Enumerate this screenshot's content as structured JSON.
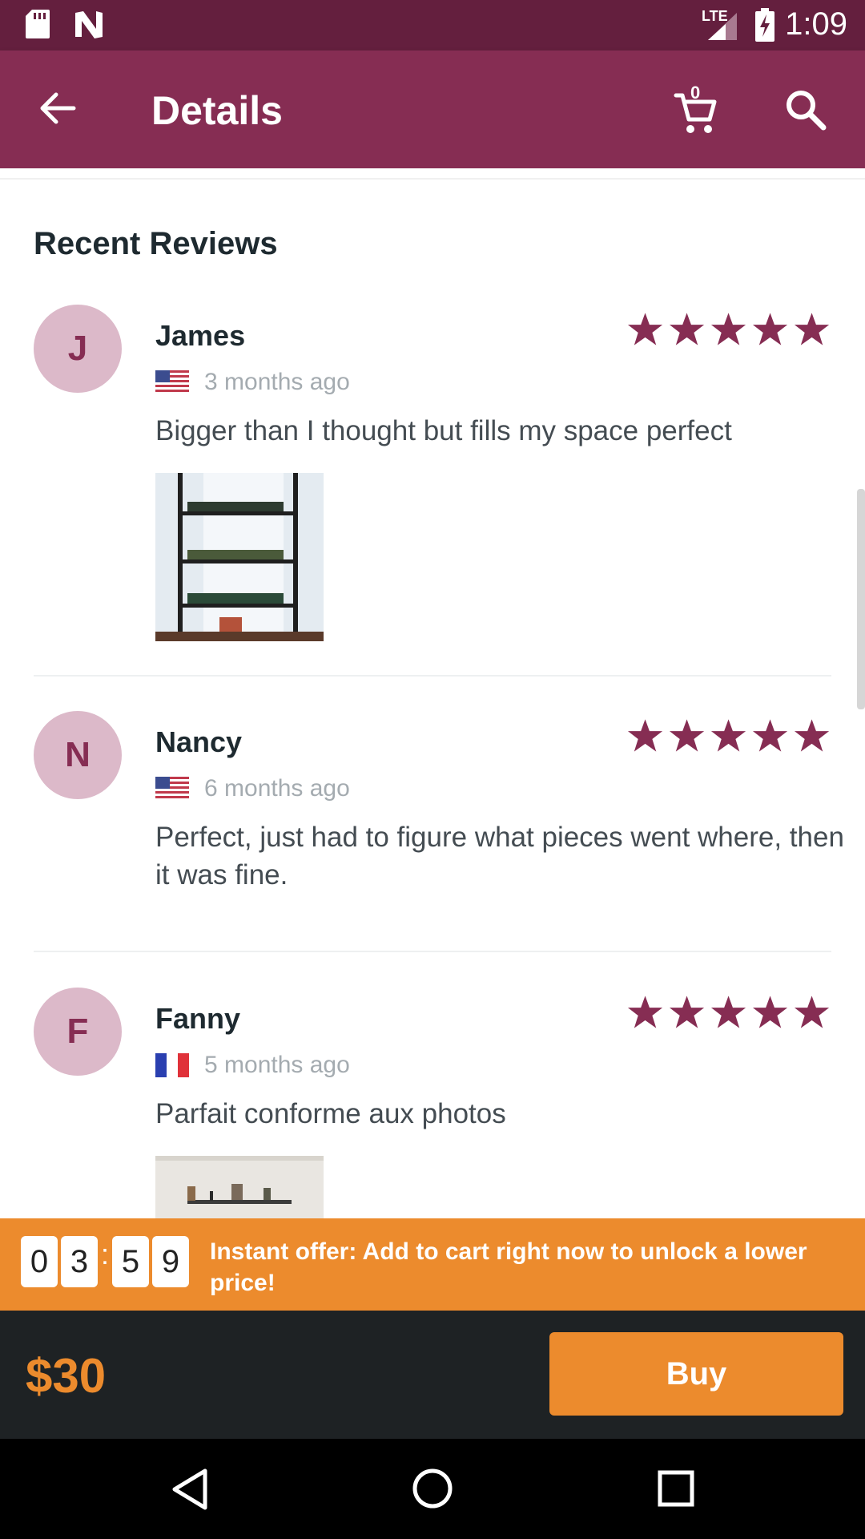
{
  "status_bar": {
    "time": "1:09",
    "network": "LTE"
  },
  "app_bar": {
    "title": "Details",
    "cart_count": "0"
  },
  "section_title": "Recent Reviews",
  "reviews": [
    {
      "initial": "J",
      "name": "James",
      "time": "3 months ago",
      "flag": "us-flag-icon",
      "rating": 5,
      "text": "Bigger than I thought but fills my space perfect",
      "has_photo": true
    },
    {
      "initial": "N",
      "name": "Nancy",
      "time": "6 months ago",
      "flag": "us-flag-icon",
      "rating": 5,
      "text": "Perfect, just had to figure what pieces went where, then it was fine.",
      "has_photo": false
    },
    {
      "initial": "F",
      "name": "Fanny",
      "time": "5 months ago",
      "flag": "fr-flag-icon",
      "rating": 5,
      "text": "Parfait conforme aux photos",
      "has_photo": true
    }
  ],
  "offer": {
    "timer": [
      "0",
      "3",
      "5",
      "9"
    ],
    "text": "Instant offer: Add to cart right now to unlock a lower price!"
  },
  "price": "$30",
  "buy_label": "Buy",
  "colors": {
    "primary": "#862d53",
    "status_bar": "#641f3e",
    "accent": "#ec8b2d",
    "star": "#862d53"
  }
}
